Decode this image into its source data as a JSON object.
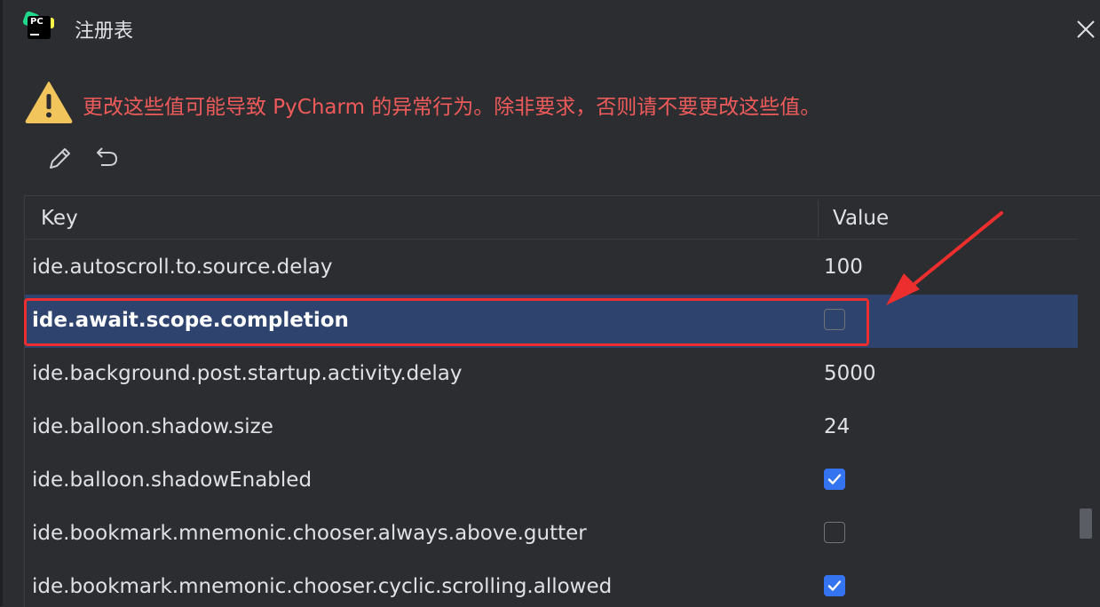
{
  "window": {
    "title": "注册表",
    "close_icon": "close-icon",
    "logo": "pycharm-logo",
    "logo_text": "PC"
  },
  "warning": {
    "icon": "warning-triangle-icon",
    "text": "更改这些值可能导致 PyCharm 的异常行为。除非要求，否则请不要更改这些值。",
    "color": "#ef5b5b"
  },
  "toolbar": {
    "edit_icon": "pencil-icon",
    "revert_icon": "undo-icon"
  },
  "table": {
    "columns": {
      "key": "Key",
      "value": "Value"
    },
    "rows": [
      {
        "key": "ide.autoscroll.to.source.delay",
        "type": "text",
        "value": "100"
      },
      {
        "key": "ide.await.scope.completion",
        "type": "checkbox",
        "checked": false,
        "selected": true
      },
      {
        "key": "ide.background.post.startup.activity.delay",
        "type": "text",
        "value": "5000"
      },
      {
        "key": "ide.balloon.shadow.size",
        "type": "text",
        "value": "24"
      },
      {
        "key": "ide.balloon.shadowEnabled",
        "type": "checkbox",
        "checked": true
      },
      {
        "key": "ide.bookmark.mnemonic.chooser.always.above.gutter",
        "type": "checkbox",
        "checked": false
      },
      {
        "key": "ide.bookmark.mnemonic.chooser.cyclic.scrolling.allowed",
        "type": "checkbox",
        "checked": true
      }
    ]
  },
  "annotation": {
    "highlight_color": "#ec2e2e",
    "arrow_color": "#ec2e2e"
  },
  "colors": {
    "background": "#2b2d30",
    "selection": "#2e436e",
    "checkbox_checked": "#3574f0"
  }
}
